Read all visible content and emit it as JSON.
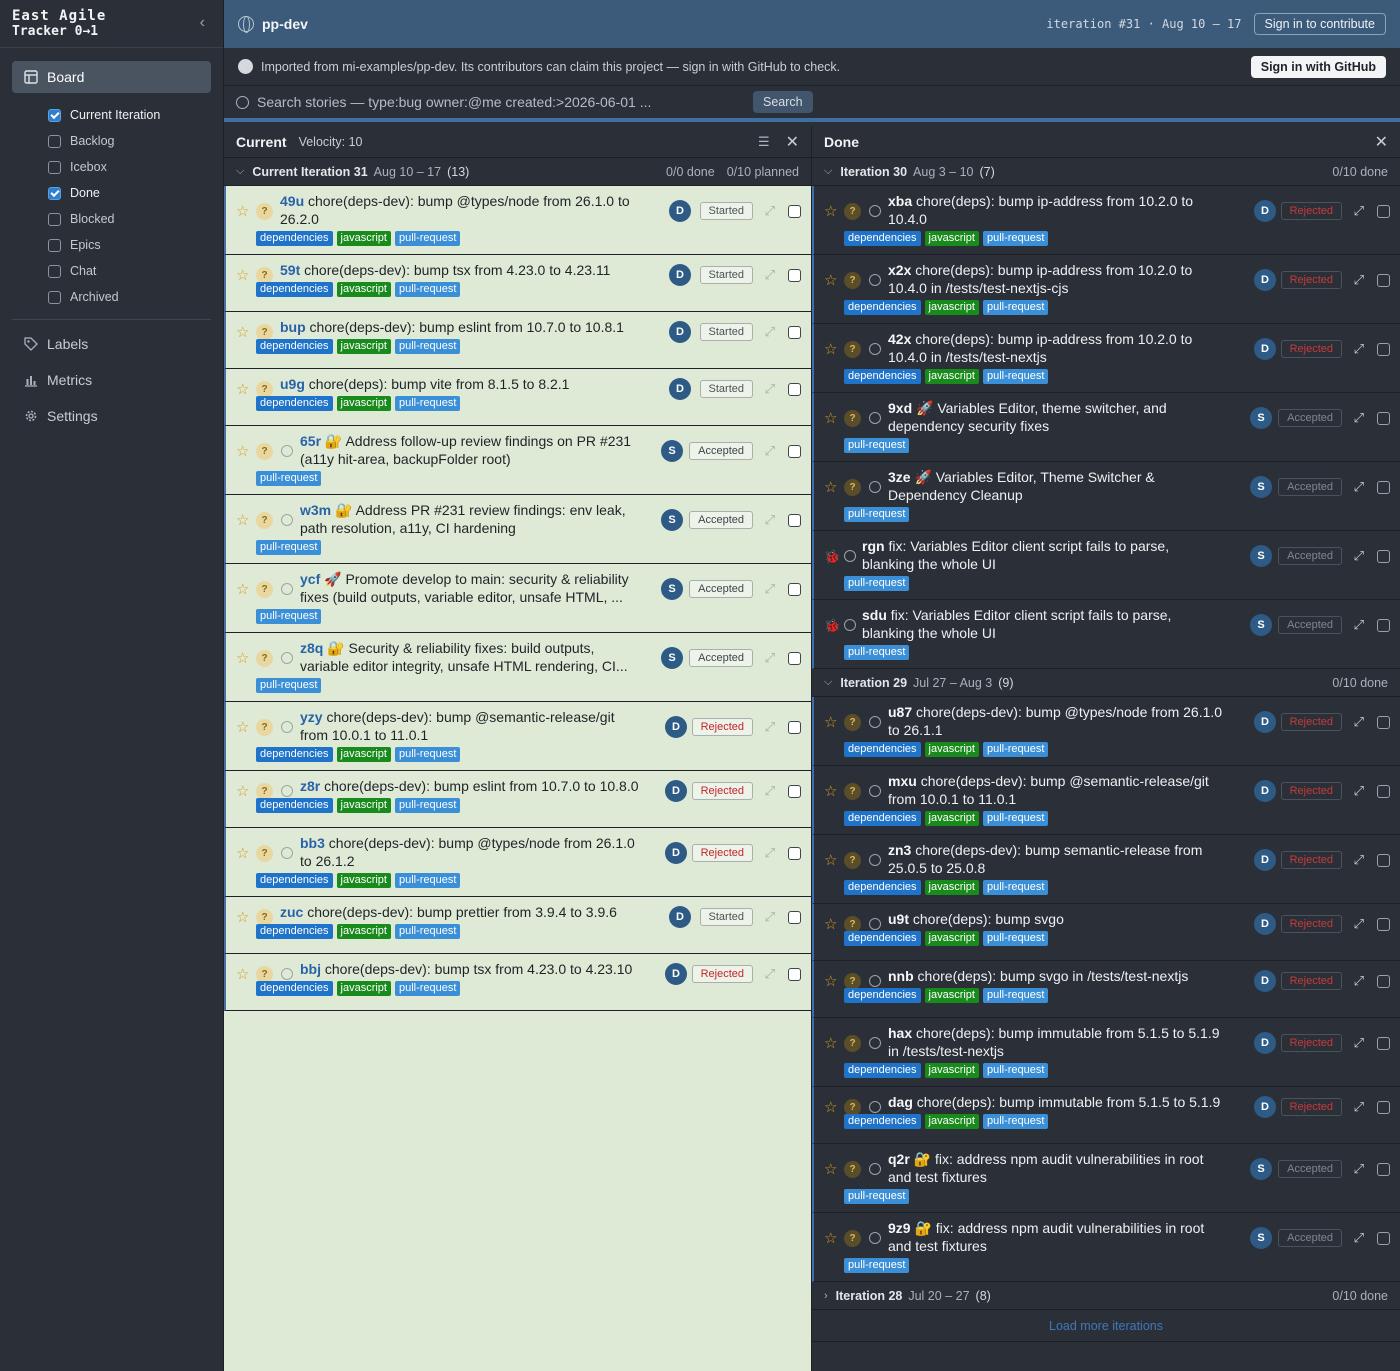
{
  "brand": {
    "line1": "East Agile",
    "line2": "Tracker 0→1",
    "collapse": "‹"
  },
  "nav": {
    "board": "Board",
    "panels": [
      {
        "label": "Current Iteration",
        "checked": true
      },
      {
        "label": "Backlog",
        "checked": false
      },
      {
        "label": "Icebox",
        "checked": false
      },
      {
        "label": "Done",
        "checked": true
      },
      {
        "label": "Blocked",
        "checked": false
      },
      {
        "label": "Epics",
        "checked": false
      },
      {
        "label": "Chat",
        "checked": false
      },
      {
        "label": "Archived",
        "checked": false
      }
    ],
    "labels": "Labels",
    "metrics": "Metrics",
    "settings": "Settings"
  },
  "topbar": {
    "project": "pp-dev",
    "iteration": "iteration #31 · Aug 10 – 17",
    "signin": "Sign in to contribute"
  },
  "banner": {
    "message": "Imported from mi-examples/pp-dev. Its contributors can claim this project — sign in with GitHub to check.",
    "button": "Sign in with GitHub"
  },
  "search": {
    "placeholder": "Search stories — type:bug owner:@me created:>2026-06-01 ...",
    "button": "Search"
  },
  "current": {
    "title": "Current",
    "velocity": "Velocity: 10",
    "iteration": {
      "name": "Current Iteration 31",
      "dates": "Aug 10 – 17",
      "count": "(13)",
      "done": "0/0 done",
      "planned": "0/10 planned"
    },
    "stories": [
      {
        "id": "49u",
        "title": "chore(deps-dev): bump @types/node from 26.1.0 to",
        "title2": "26.2.0",
        "owner": "D",
        "state": "Started",
        "labels": [
          "dependencies",
          "javascript",
          "pull-request"
        ],
        "bubble": false,
        "emoji": ""
      },
      {
        "id": "59t",
        "title": "chore(deps-dev): bump tsx from 4.23.0 to 4.23.11",
        "title2": "",
        "owner": "D",
        "state": "Started",
        "labels": [
          "dependencies",
          "javascript",
          "pull-request"
        ],
        "bubble": false,
        "emoji": ""
      },
      {
        "id": "bup",
        "title": "chore(deps-dev): bump eslint from 10.7.0 to 10.8.1",
        "title2": "",
        "owner": "D",
        "state": "Started",
        "labels": [
          "dependencies",
          "javascript",
          "pull-request"
        ],
        "bubble": false,
        "emoji": ""
      },
      {
        "id": "u9g",
        "title": "chore(deps): bump vite from 8.1.5 to 8.2.1",
        "title2": "",
        "owner": "D",
        "state": "Started",
        "labels": [
          "dependencies",
          "javascript",
          "pull-request"
        ],
        "bubble": false,
        "emoji": ""
      },
      {
        "id": "65r",
        "title": "🔐 Address follow-up review findings on PR #231",
        "title2": "(a11y hit-area, backupFolder root)",
        "owner": "S",
        "state": "Accepted",
        "labels": [
          "pull-request"
        ],
        "bubble": true,
        "emoji": ""
      },
      {
        "id": "w3m",
        "title": "🔐 Address PR #231 review findings: env leak,",
        "title2": "path resolution, a11y, CI hardening",
        "owner": "S",
        "state": "Accepted",
        "labels": [
          "pull-request"
        ],
        "bubble": true,
        "emoji": ""
      },
      {
        "id": "ycf",
        "title": "🚀 Promote develop to main: security & reliability",
        "title2": "fixes (build outputs, variable editor, unsafe HTML, ...",
        "owner": "S",
        "state": "Accepted",
        "labels": [
          "pull-request"
        ],
        "bubble": true,
        "emoji": ""
      },
      {
        "id": "z8q",
        "title": "🔐 Security & reliability fixes: build outputs,",
        "title2": "variable editor integrity, unsafe HTML rendering, CI...",
        "owner": "S",
        "state": "Accepted",
        "labels": [
          "pull-request"
        ],
        "bubble": true,
        "emoji": ""
      },
      {
        "id": "yzy",
        "title": "chore(deps-dev): bump @semantic-release/git",
        "title2": "from 10.0.1 to 11.0.1",
        "owner": "D",
        "state": "Rejected",
        "labels": [
          "dependencies",
          "javascript",
          "pull-request"
        ],
        "bubble": true,
        "emoji": ""
      },
      {
        "id": "z8r",
        "title": "chore(deps-dev): bump eslint from 10.7.0 to 10.8.0",
        "title2": "",
        "owner": "D",
        "state": "Rejected",
        "labels": [
          "dependencies",
          "javascript",
          "pull-request"
        ],
        "bubble": true,
        "emoji": ""
      },
      {
        "id": "bb3",
        "title": "chore(deps-dev): bump @types/node from 26.1.0",
        "title2": "to 26.1.2",
        "owner": "D",
        "state": "Rejected",
        "labels": [
          "dependencies",
          "javascript",
          "pull-request"
        ],
        "bubble": true,
        "emoji": ""
      },
      {
        "id": "zuc",
        "title": "chore(deps-dev): bump prettier from 3.9.4 to 3.9.6",
        "title2": "",
        "owner": "D",
        "state": "Started",
        "labels": [
          "dependencies",
          "javascript",
          "pull-request"
        ],
        "bubble": false,
        "emoji": ""
      },
      {
        "id": "bbj",
        "title": "chore(deps-dev): bump tsx from 4.23.0 to 4.23.10",
        "title2": "",
        "owner": "D",
        "state": "Rejected",
        "labels": [
          "dependencies",
          "javascript",
          "pull-request"
        ],
        "bubble": true,
        "emoji": ""
      }
    ]
  },
  "done": {
    "title": "Done",
    "iterations": [
      {
        "name": "Iteration 30",
        "dates": "Aug 3 – 10",
        "count": "(7)",
        "done": "0/10 done",
        "expanded": true,
        "stories": [
          {
            "id": "xba",
            "title": "chore(deps): bump ip-address from 10.2.0 to",
            "title2": "10.4.0",
            "owner": "D",
            "state": "Rejected",
            "labels": [
              "dependencies",
              "javascript",
              "pull-request"
            ],
            "bug": false
          },
          {
            "id": "x2x",
            "title": "chore(deps): bump ip-address from 10.2.0 to",
            "title2": "10.4.0 in /tests/test-nextjs-cjs",
            "owner": "D",
            "state": "Rejected",
            "labels": [
              "dependencies",
              "javascript",
              "pull-request"
            ],
            "bug": false
          },
          {
            "id": "42x",
            "title": "chore(deps): bump ip-address from 10.2.0 to",
            "title2": "10.4.0 in /tests/test-nextjs",
            "owner": "D",
            "state": "Rejected",
            "labels": [
              "dependencies",
              "javascript",
              "pull-request"
            ],
            "bug": false
          },
          {
            "id": "9xd",
            "title": "🚀 Variables Editor, theme switcher, and",
            "title2": "dependency security fixes",
            "owner": "S",
            "state": "Accepted",
            "labels": [
              "pull-request"
            ],
            "bug": false
          },
          {
            "id": "3ze",
            "title": "🚀 Variables Editor, Theme Switcher &",
            "title2": "Dependency Cleanup",
            "owner": "S",
            "state": "Accepted",
            "labels": [
              "pull-request"
            ],
            "bug": false
          },
          {
            "id": "rgn",
            "title": "fix: Variables Editor client script fails to parse,",
            "title2": "blanking the whole UI",
            "owner": "S",
            "state": "Accepted",
            "labels": [
              "pull-request"
            ],
            "bug": true
          },
          {
            "id": "sdu",
            "title": "fix: Variables Editor client script fails to parse,",
            "title2": "blanking the whole UI",
            "owner": "S",
            "state": "Accepted",
            "labels": [
              "pull-request"
            ],
            "bug": true
          }
        ]
      },
      {
        "name": "Iteration 29",
        "dates": "Jul 27 – Aug 3",
        "count": "(9)",
        "done": "0/10 done",
        "expanded": true,
        "stories": [
          {
            "id": "u87",
            "title": "chore(deps-dev): bump @types/node from 26.1.0",
            "title2": "to 26.1.1",
            "owner": "D",
            "state": "Rejected",
            "labels": [
              "dependencies",
              "javascript",
              "pull-request"
            ],
            "bug": false
          },
          {
            "id": "mxu",
            "title": "chore(deps-dev): bump @semantic-release/git",
            "title2": "from 10.0.1 to 11.0.1",
            "owner": "D",
            "state": "Rejected",
            "labels": [
              "dependencies",
              "javascript",
              "pull-request"
            ],
            "bug": false
          },
          {
            "id": "zn3",
            "title": "chore(deps-dev): bump semantic-release from",
            "title2": "25.0.5 to 25.0.8",
            "owner": "D",
            "state": "Rejected",
            "labels": [
              "dependencies",
              "javascript",
              "pull-request"
            ],
            "bug": false
          },
          {
            "id": "u9t",
            "title": "chore(deps): bump svgo",
            "title2": "",
            "owner": "D",
            "state": "Rejected",
            "labels": [
              "dependencies",
              "javascript",
              "pull-request"
            ],
            "bug": false
          },
          {
            "id": "nnb",
            "title": "chore(deps): bump svgo in /tests/test-nextjs",
            "title2": "",
            "owner": "D",
            "state": "Rejected",
            "labels": [
              "dependencies",
              "javascript",
              "pull-request"
            ],
            "bug": false
          },
          {
            "id": "hax",
            "title": "chore(deps): bump immutable from 5.1.5 to 5.1.9",
            "title2": "in /tests/test-nextjs",
            "owner": "D",
            "state": "Rejected",
            "labels": [
              "dependencies",
              "javascript",
              "pull-request"
            ],
            "bug": false
          },
          {
            "id": "dag",
            "title": "chore(deps): bump immutable from 5.1.5 to 5.1.9",
            "title2": "",
            "owner": "D",
            "state": "Rejected",
            "labels": [
              "dependencies",
              "javascript",
              "pull-request"
            ],
            "bug": false
          },
          {
            "id": "q2r",
            "title": "🔐 fix: address npm audit vulnerabilities in root",
            "title2": "and test fixtures",
            "owner": "S",
            "state": "Accepted",
            "labels": [
              "pull-request"
            ],
            "bug": false
          },
          {
            "id": "9z9",
            "title": "🔐 fix: address npm audit vulnerabilities in root",
            "title2": "and test fixtures",
            "owner": "S",
            "state": "Accepted",
            "labels": [
              "pull-request"
            ],
            "bug": false
          }
        ]
      },
      {
        "name": "Iteration 28",
        "dates": "Jul 20 – 27",
        "count": "(8)",
        "done": "0/10 done",
        "expanded": false,
        "stories": []
      }
    ],
    "load_more": "Load more iterations"
  },
  "icons": {
    "star": "star-icon",
    "unestimated": "?",
    "expand": "expand-icon",
    "bug": "bug-icon",
    "comment": "comment-icon"
  },
  "colors": {
    "topbar": "#3c5a79",
    "current_bg": "#dfead6",
    "done_bg": "#2b3038",
    "rejected": "#c3262a",
    "label_dependencies": "#1f73c9",
    "label_javascript": "#198a1c",
    "label_pr": "#3a8fd6"
  }
}
